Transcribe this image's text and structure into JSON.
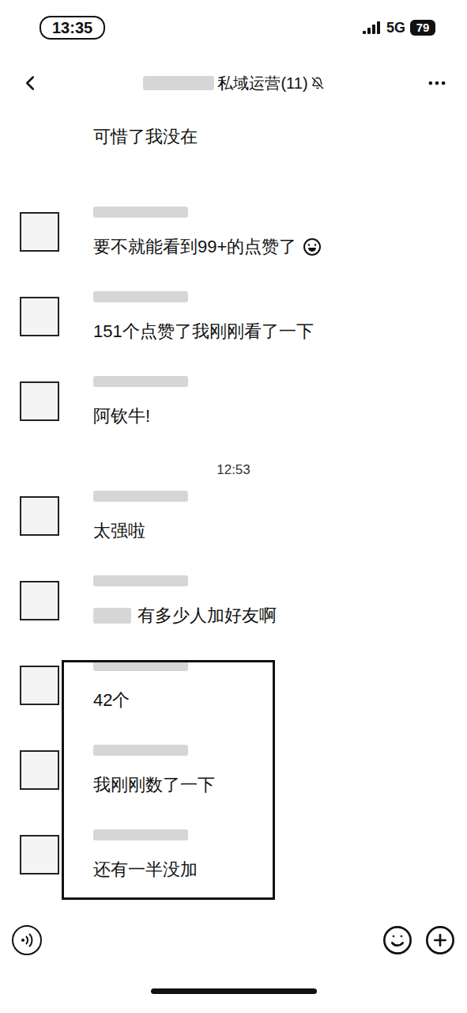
{
  "status_bar": {
    "time": "13:35",
    "network": "5G",
    "battery": "79"
  },
  "header": {
    "title": "私域运营(11)",
    "muted": true
  },
  "messages": [
    {
      "kind": "message",
      "text": "可惜了我没在",
      "avatar": false,
      "emoji": false,
      "redacted_prefix": false,
      "highlighted": false
    },
    {
      "kind": "message",
      "text": "要不就能看到99+的点赞了",
      "avatar": true,
      "emoji": true,
      "redacted_prefix": false,
      "highlighted": false
    },
    {
      "kind": "message",
      "text": "151个点赞了我刚刚看了一下",
      "avatar": true,
      "emoji": false,
      "redacted_prefix": false,
      "highlighted": false
    },
    {
      "kind": "message",
      "text": "阿钦牛!",
      "avatar": true,
      "emoji": false,
      "redacted_prefix": false,
      "highlighted": false
    },
    {
      "kind": "time",
      "text": "12:53",
      "avatar": false,
      "emoji": false,
      "redacted_prefix": false,
      "highlighted": false
    },
    {
      "kind": "message",
      "text": "太强啦",
      "avatar": true,
      "emoji": false,
      "redacted_prefix": false,
      "highlighted": false
    },
    {
      "kind": "message",
      "text": "有多少人加好友啊",
      "avatar": true,
      "emoji": false,
      "redacted_prefix": true,
      "highlighted": false
    },
    {
      "kind": "message",
      "text": "42个",
      "avatar": true,
      "emoji": false,
      "redacted_prefix": false,
      "highlighted": true
    },
    {
      "kind": "message",
      "text": "我刚刚数了一下",
      "avatar": true,
      "emoji": false,
      "redacted_prefix": false,
      "highlighted": true
    },
    {
      "kind": "message",
      "text": "还有一半没加",
      "avatar": true,
      "emoji": false,
      "redacted_prefix": false,
      "highlighted": true
    }
  ]
}
